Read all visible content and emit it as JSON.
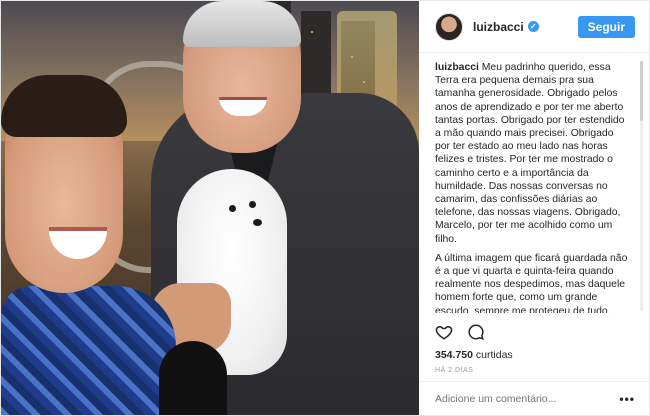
{
  "post": {
    "username": "luizbacci",
    "follow_label": "Seguir",
    "caption_user": "luizbacci",
    "caption_paragraphs": [
      "Meu padrinho querido, essa Terra era pequena demais pra sua tamanha generosidade. Obrigado pelos anos de aprendizado e por ter me aberto tantas portas. Obrigado por ter estendido a mão quando mais precisei. Obrigado por ter estado ao meu lado nas horas felizes e tristes. Por ter me mostrado o caminho certo e a importância da humildade. Das nossas conversas no camarim, das confissões diárias ao telefone, das nossas viagens. Obrigado, Marcelo, por ter me acolhido como um filho.",
      "A última imagem que ficará guardada não é a que vi quarta e quinta-feira quando realmente nos despedimos, mas daquele homem forte que, como um grande escudo, sempre me protegeu de tudo. Agradeço a Deus por ter tido a chance de dizer tudo isso a você ainda consciente."
    ],
    "likes_count": "354.750",
    "likes_label": "curtidas",
    "time_ago": "HÁ 2 DIAS",
    "comment_placeholder": "Adicione um comentário...",
    "more_label": "•••",
    "verified_mark": "✓",
    "colors": {
      "accent": "#3897f0",
      "text": "#262626",
      "muted": "#999999"
    },
    "icons": [
      "verified-badge-icon",
      "heart-icon",
      "comment-icon",
      "more-options-icon"
    ]
  }
}
